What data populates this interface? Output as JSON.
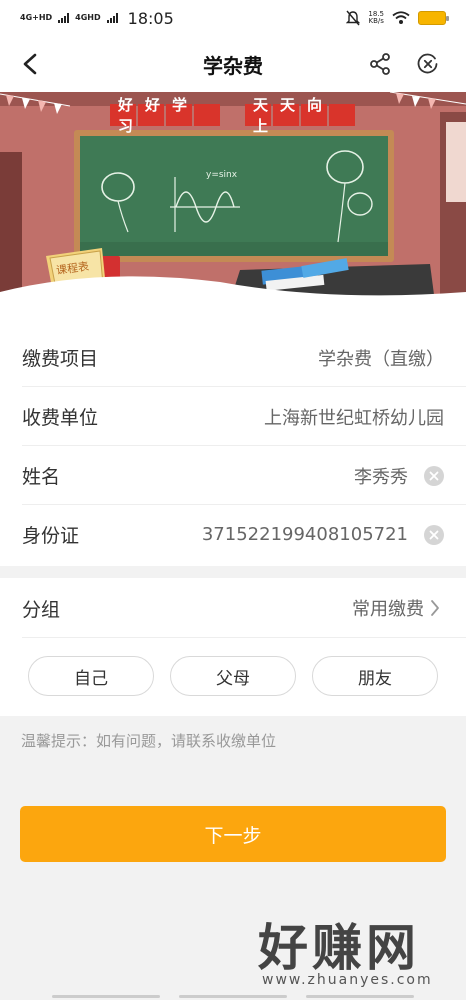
{
  "status_bar": {
    "network_1": "4G+HD",
    "network_2": "4GHD",
    "time": "18:05",
    "speed_value": "18.5",
    "speed_unit": "KB/s"
  },
  "nav": {
    "title": "学杂费"
  },
  "banner": {
    "slogan_left": "好好学习",
    "slogan_right": "天天向上",
    "board_formula": "y=sinx",
    "schedule_label": "课程表"
  },
  "form": {
    "rows": [
      {
        "label": "缴费项目",
        "value": "学杂费（直缴）"
      },
      {
        "label": "收费单位",
        "value": "上海新世纪虹桥幼儿园"
      },
      {
        "label": "姓名",
        "value": "李秀秀"
      },
      {
        "label": "身份证",
        "value": "371522199408105721"
      }
    ]
  },
  "group": {
    "label": "分组",
    "value": "常用缴费",
    "chips": [
      "自己",
      "父母",
      "朋友"
    ]
  },
  "tip": "温馨提示：如有问题，请联系收缴单位",
  "next_button": "下一步",
  "watermark": {
    "text": "好赚网",
    "url": "www.zhuanyes.com"
  },
  "colors": {
    "accent": "#fca60e",
    "board": "#3f7a55",
    "wall": "#c0706a"
  }
}
